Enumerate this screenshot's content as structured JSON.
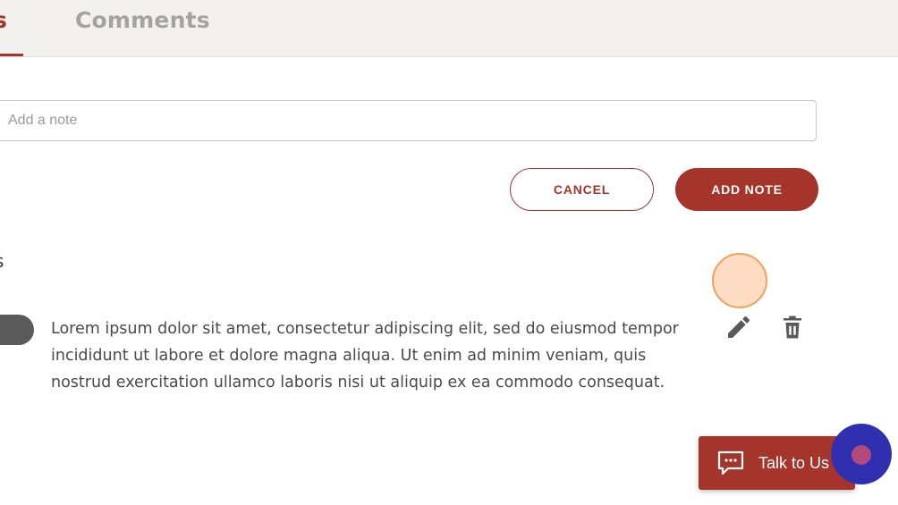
{
  "tabs": [
    {
      "label": "Notes",
      "visible_fragment": "s",
      "active": true
    },
    {
      "label": "Comments",
      "active": false
    }
  ],
  "note_input": {
    "placeholder": "Add a note",
    "value": ""
  },
  "actions": {
    "cancel_label": "CANCEL",
    "add_label": "ADD NOTE"
  },
  "section": {
    "title_fragment": "s"
  },
  "notes": [
    {
      "text": "Lorem ipsum dolor sit amet, consectetur adipiscing elit, sed do eiusmod tempor incididunt ut labore et dolore magna aliqua. Ut enim ad minim veniam, quis nostrud exercitation ullamco laboris nisi ut aliquip ex ea commodo consequat."
    }
  ],
  "support": {
    "label": "Talk to Us"
  },
  "icons": {
    "edit": "pencil-icon",
    "delete": "trash-icon",
    "chat": "chat-icon"
  },
  "colors": {
    "accent": "#a5342a",
    "tab_bar": "#f3f1f0",
    "chat_bubble": "#2f2fb0"
  }
}
